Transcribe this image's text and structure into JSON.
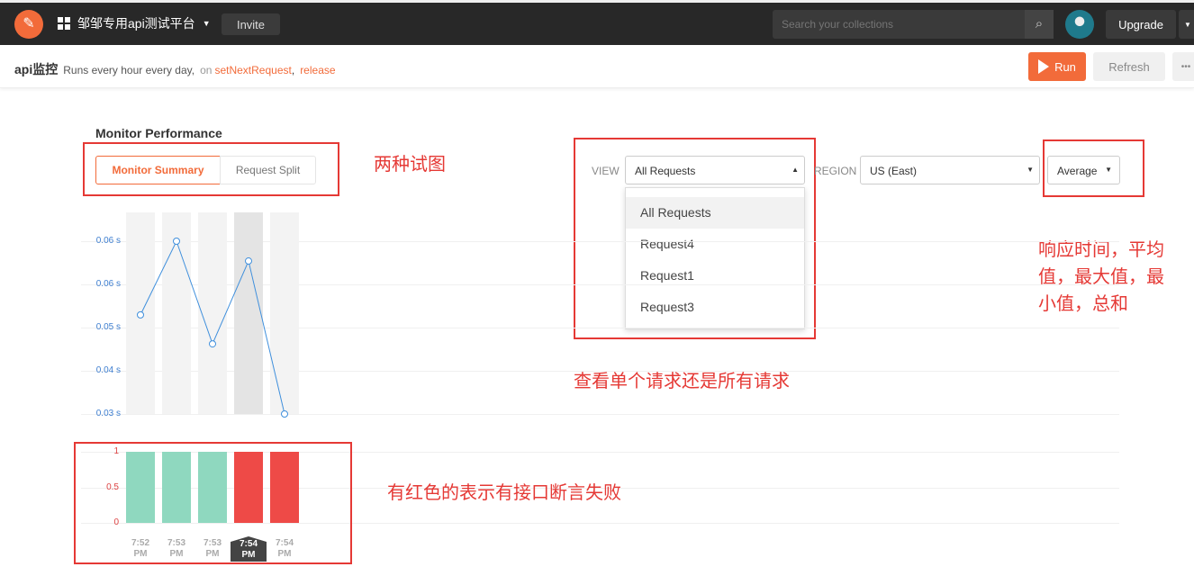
{
  "topbar": {
    "workspace": "邹邹专用api测试平台",
    "invite": "Invite",
    "search_placeholder": "Search your collections",
    "upgrade": "Upgrade"
  },
  "monitor": {
    "name": "api监控",
    "schedule": "Runs every hour every day,",
    "on": "on",
    "collection": "setNextRequest",
    "environment": "release",
    "run": "Run",
    "refresh": "Refresh",
    "more": "•••"
  },
  "performance": {
    "title": "Monitor Performance",
    "tabs": [
      {
        "label": "Monitor Summary",
        "active": true
      },
      {
        "label": "Request Split",
        "active": false
      }
    ],
    "view_label": "VIEW",
    "view_value": "All Requests",
    "view_options": [
      "All Requests",
      "Request4",
      "Request1",
      "Request3"
    ],
    "region_label": "REGION",
    "region_value": "US (East)",
    "metric_value": "Average"
  },
  "annotations": {
    "views": "两种试图",
    "request_scope": "查看单个请求还是所有请求",
    "metrics": [
      "响应时间，平均",
      "值，最大值，最",
      "小值，总和"
    ],
    "failures": "有红色的表示有接口断言失败"
  },
  "colors": {
    "accent": "#f26b3a",
    "pass": "#8fd8bf",
    "fail": "#ee4a47",
    "line": "#3f8fdc"
  },
  "chart_data": [
    {
      "type": "line",
      "categories": [
        "7:52 PM",
        "7:53 PM",
        "7:53 PM",
        "7:54 PM",
        "7:54 PM"
      ],
      "values": [
        0.0495,
        0.064,
        0.0438,
        0.0601,
        0.03
      ],
      "yticks": [
        "0.03 s",
        "0.04 s",
        "0.05 s",
        "0.06 s",
        "0.06 s"
      ],
      "ylim": [
        0.03,
        0.064
      ],
      "highlighted_index": 3
    },
    {
      "type": "bar",
      "categories": [
        "7:52 PM",
        "7:53 PM",
        "7:53 PM",
        "7:54 PM",
        "7:54 PM"
      ],
      "values": [
        1,
        1,
        1,
        1,
        1
      ],
      "status": [
        "pass",
        "pass",
        "pass",
        "fail",
        "fail"
      ],
      "yticks": [
        "0",
        "0.5",
        "1"
      ],
      "ylim": [
        0,
        1
      ],
      "xlabels": [
        [
          "7:52",
          "PM"
        ],
        [
          "7:53",
          "PM"
        ],
        [
          "7:53",
          "PM"
        ],
        [
          "7:54",
          "PM"
        ],
        [
          "7:54",
          "PM"
        ]
      ]
    }
  ]
}
